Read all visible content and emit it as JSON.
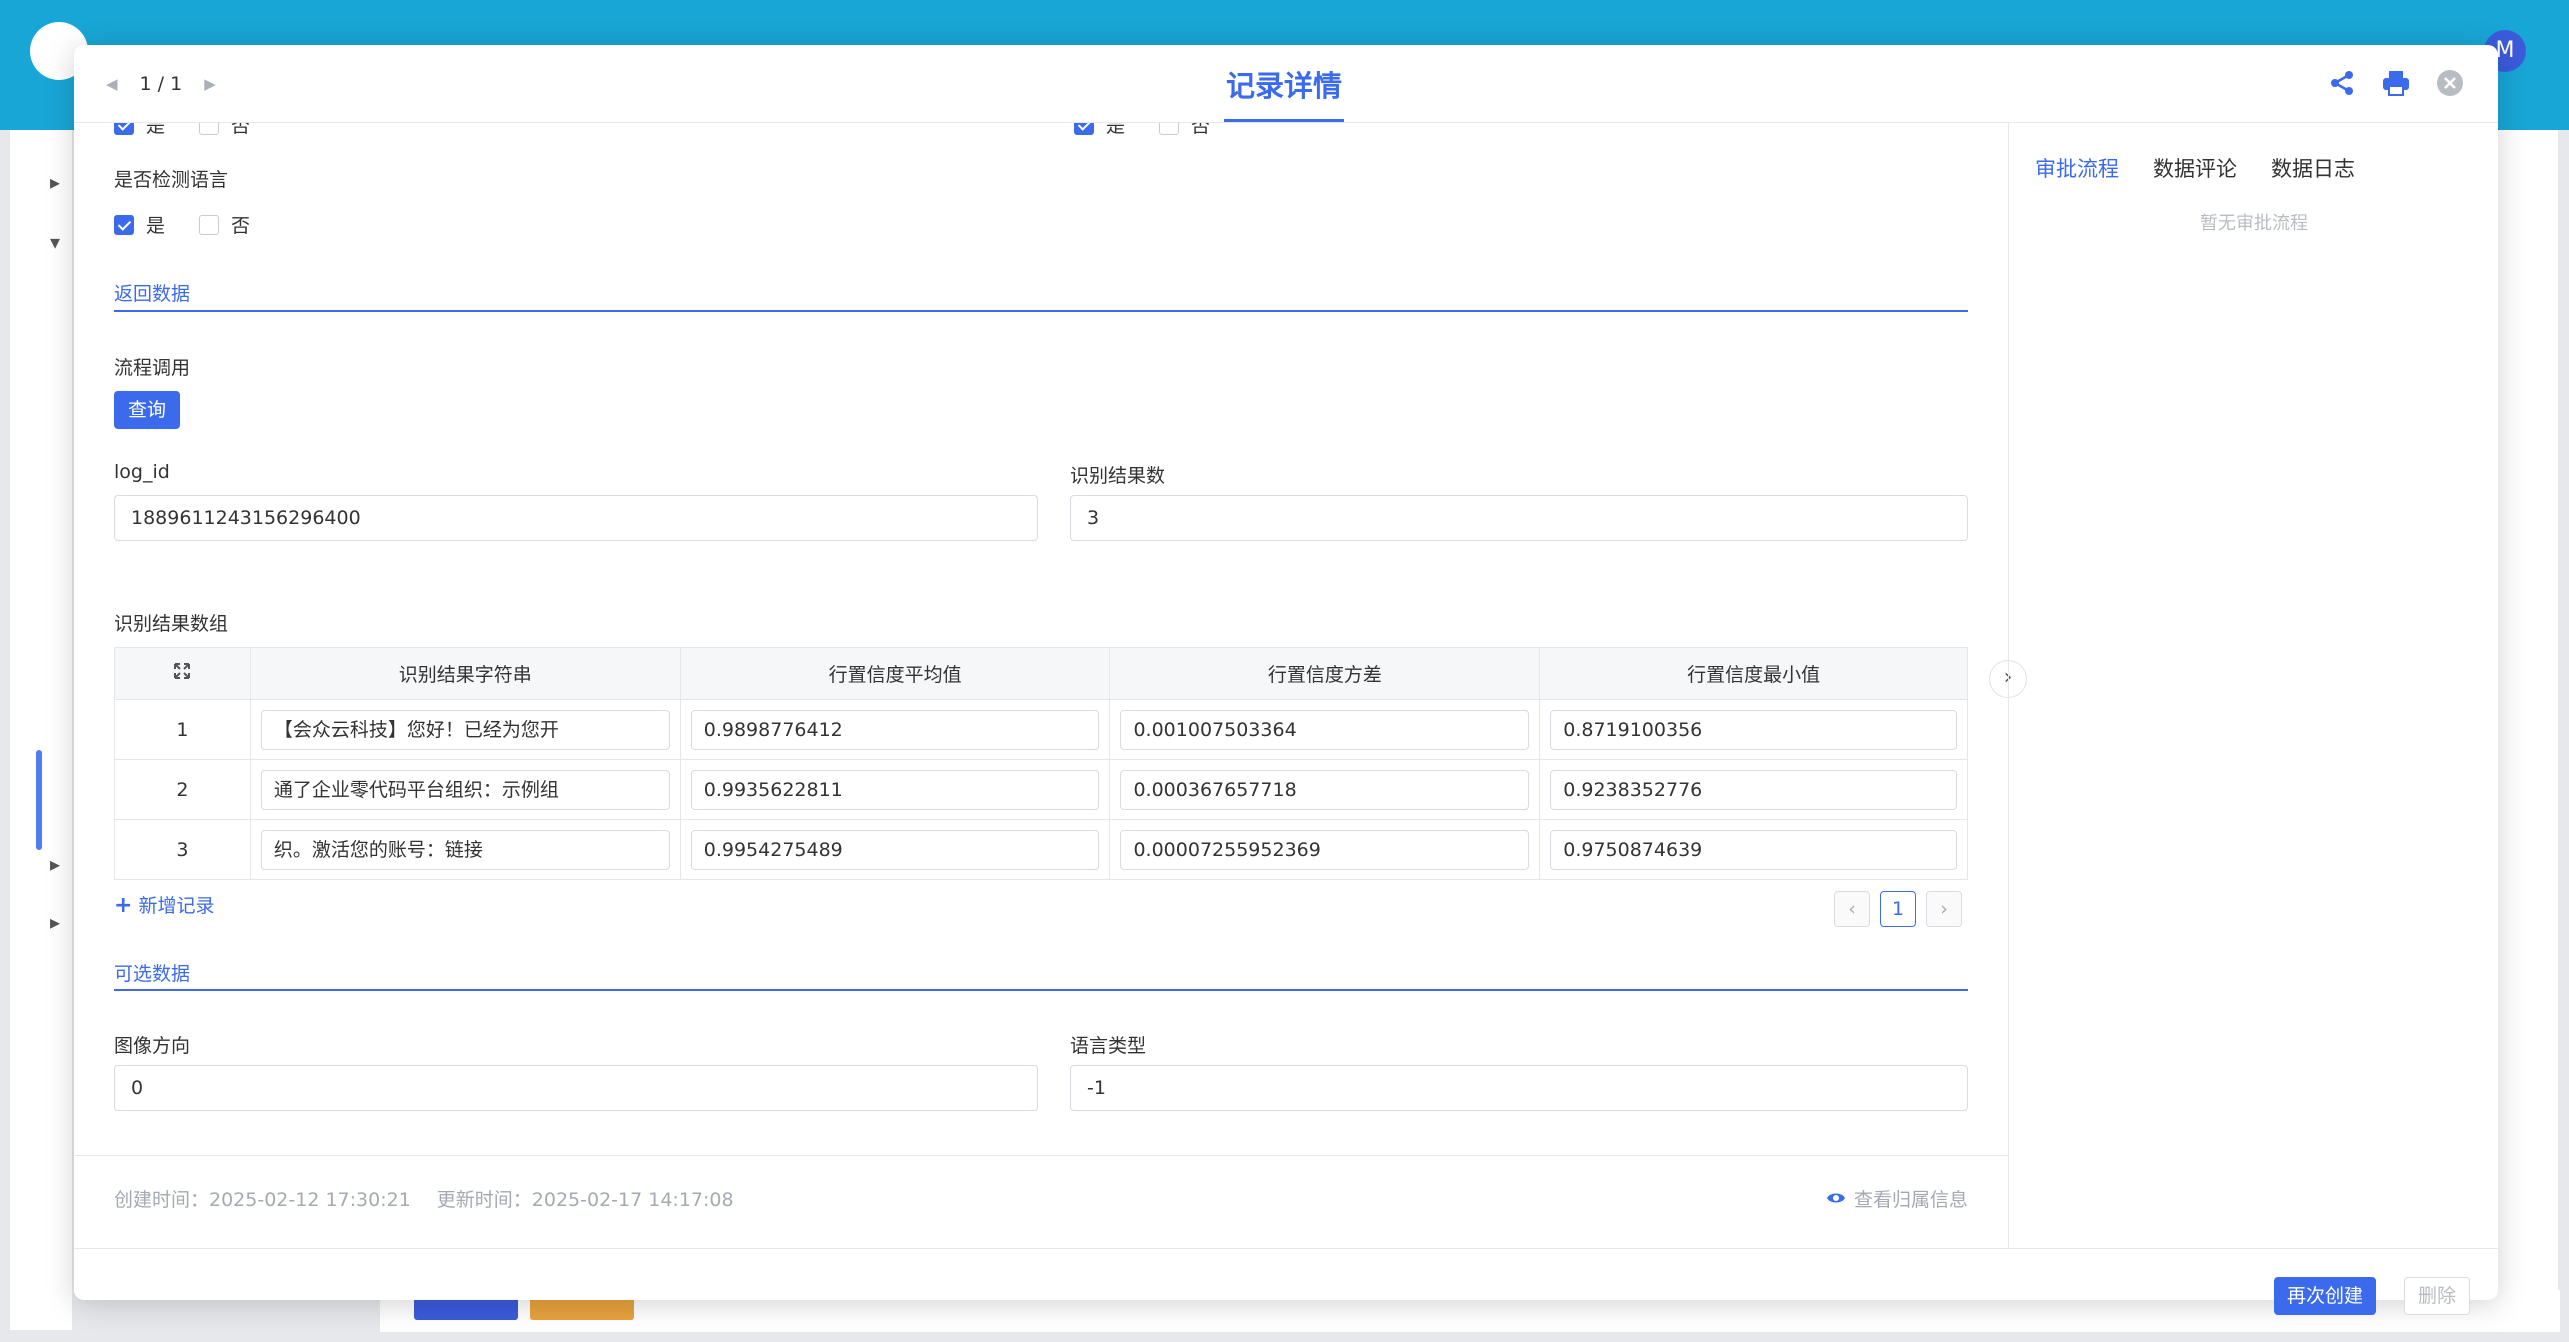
{
  "header": {
    "pager": "1 / 1",
    "title": "记录详情"
  },
  "fields": {
    "top_cb_yes": "是",
    "top_cb_no": "否",
    "detect_lang_label": "是否检测语言",
    "detect_lang_yes": "是",
    "detect_lang_no": "否"
  },
  "section_return": "返回数据",
  "flow_call": {
    "label": "流程调用",
    "button": "查询"
  },
  "log_id": {
    "label": "log_id",
    "value": "1889611243156296400"
  },
  "result_count": {
    "label": "识别结果数",
    "value": "3"
  },
  "result_array": {
    "label": "识别结果数组",
    "columns": [
      "识别结果字符串",
      "行置信度平均值",
      "行置信度方差",
      "行置信度最小值"
    ],
    "rows": [
      {
        "idx": "1",
        "text": "【会众云科技】您好！已经为您开",
        "avg": "0.9898776412",
        "var": "0.001007503364",
        "min": "0.8719100356"
      },
      {
        "idx": "2",
        "text": "通了企业零代码平台组织：示例组",
        "avg": "0.9935622811",
        "var": "0.000367657718",
        "min": "0.9238352776"
      },
      {
        "idx": "3",
        "text": "织。激活您的账号：链接",
        "avg": "0.9954275489",
        "var": "0.00007255952369",
        "min": "0.9750874639"
      }
    ],
    "add": "新增记录",
    "page": "1"
  },
  "section_optional": "可选数据",
  "image_direction": {
    "label": "图像方向",
    "value": "0"
  },
  "language_type": {
    "label": "语言类型",
    "value": "-1"
  },
  "meta": {
    "created": "创建时间：2025-02-12 17:30:21",
    "updated": "更新时间：2025-02-17 14:17:08",
    "view_owner": "查看归属信息"
  },
  "right_panel": {
    "tabs": [
      "审批流程",
      "数据评论",
      "数据日志"
    ],
    "empty": "暂无审批流程"
  },
  "footer": {
    "recreate": "再次创建",
    "delete": "删除"
  },
  "colors": {
    "accent": "#3b6bec",
    "appbar": "#18a6d6"
  }
}
